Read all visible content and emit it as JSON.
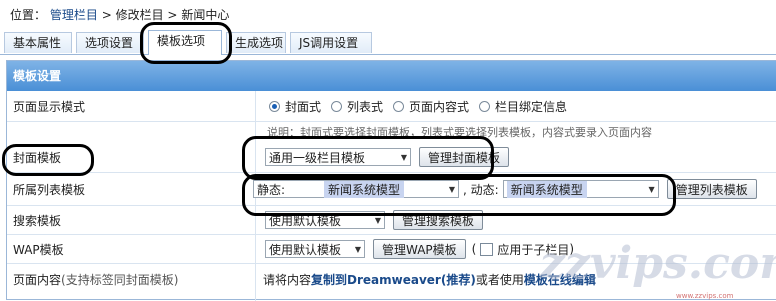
{
  "breadcrumb": {
    "prefix": "位置：",
    "items": [
      "管理栏目",
      ">",
      "修改栏目",
      ">",
      "新闻中心"
    ]
  },
  "tabs": [
    {
      "label": "基本属性"
    },
    {
      "label": "选项设置"
    },
    {
      "label": "模板选项"
    },
    {
      "label": "生成选项"
    },
    {
      "label": "JS调用设置"
    }
  ],
  "panel": {
    "title": "模板设置",
    "rows": {
      "display_mode": {
        "label": "页面显示模式",
        "options": [
          "封面式",
          "列表式",
          "页面内容式",
          "栏目绑定信息"
        ],
        "selected": "封面式"
      },
      "note": {
        "text": "说明：封面式要选择封面模板，列表式要选择列表模板，内容式要录入页面内容"
      },
      "cover": {
        "label": "封面模板",
        "select": "通用一级栏目模板",
        "button": "管理封面模板"
      },
      "list": {
        "label": "所属列表模板",
        "static_label": "静态:",
        "static_value": "新闻系统模型",
        "dynamic_label": ", 动态:",
        "dynamic_value": "新闻系统模型",
        "button": "管理列表模板"
      },
      "search": {
        "label": "搜索模板",
        "select": "使用默认模板",
        "button": "管理搜索模板"
      },
      "wap": {
        "label": "WAP模板",
        "select": "使用默认模板",
        "button": "管理WAP模板",
        "paren_open": "(",
        "checkbox_label": "应用于子栏目",
        "paren_close": ")"
      },
      "content": {
        "label": "页面内容",
        "label_sub": "(支持标签同封面模板)",
        "text1": "请将内容",
        "text2": "复制到Dreamweaver(推荐)",
        "text3": "或者使用",
        "text4": "模板在线编辑"
      }
    }
  },
  "watermark": {
    "text": "zzvips.com",
    "brand": "www.zzvips.com"
  }
}
